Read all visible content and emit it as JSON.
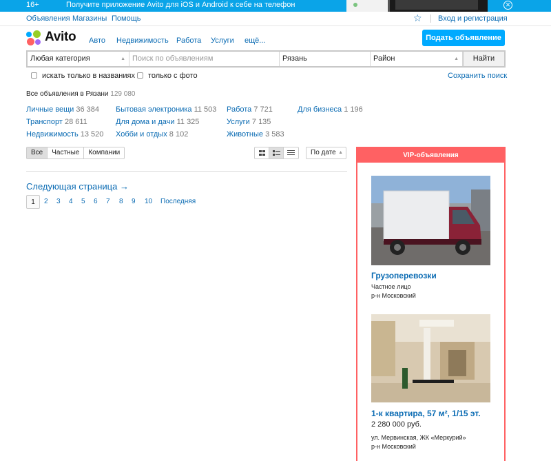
{
  "promo": {
    "age": "16+",
    "text": "Получите приложение Avito для iOS и Android к себе на телефон"
  },
  "topnav": {
    "links": [
      "Объявления",
      "Магазины",
      "Помощь"
    ],
    "login": "Вход и регистрация"
  },
  "header": {
    "logo": "Avito",
    "nav": [
      "Авто",
      "Недвижимость",
      "Работа",
      "Услуги",
      "ещё..."
    ],
    "post_button": "Подать объявление"
  },
  "search": {
    "category": "Любая категория",
    "query_placeholder": "Поиск по объявлениям",
    "city": "Рязань",
    "district": "Район",
    "submit": "Найти",
    "only_titles": "искать только в названиях",
    "only_photo": "только с фото",
    "save": "Сохранить поиск"
  },
  "summary": {
    "label": "Все объявления в Рязани",
    "count": "129 080"
  },
  "categories": [
    {
      "name": "Личные вещи",
      "count": "36 384"
    },
    {
      "name": "Транспорт",
      "count": "28 611"
    },
    {
      "name": "Недвижимость",
      "count": "13 520"
    },
    {
      "name": "Бытовая электроника",
      "count": "11 503"
    },
    {
      "name": "Для дома и дачи",
      "count": "11 325"
    },
    {
      "name": "Хобби и отдых",
      "count": "8 102"
    },
    {
      "name": "Работа",
      "count": "7 721"
    },
    {
      "name": "Услуги",
      "count": "7 135"
    },
    {
      "name": "Животные",
      "count": "3 583"
    },
    {
      "name": "Для бизнеса",
      "count": "1 196"
    }
  ],
  "filters": {
    "seller": [
      "Все",
      "Частные",
      "Компании"
    ],
    "seller_selected": "Все",
    "view_selected": "list",
    "sort": "По дате"
  },
  "pagination": {
    "next": "Следующая страница →",
    "current": "1",
    "pages": [
      "2",
      "3",
      "4",
      "5",
      "6",
      "7",
      "8",
      "9",
      "10"
    ],
    "last": "Последняя"
  },
  "vip": {
    "header": "VIP-объявления",
    "items": [
      {
        "title": "Грузоперевозки",
        "seller": "Частное лицо",
        "district": "р-н Московский"
      },
      {
        "title": "1-к квартира, 57 м², 1/15 эт.",
        "price": "2 280 000 руб.",
        "address": "ул. Мервинская, ЖК «Меркурий»",
        "district": "р-н Московский"
      }
    ]
  },
  "colors": {
    "promo": "#0aa4e8",
    "link": "#0a6bb3",
    "accent_button": "#00aaff",
    "vip": "#ff6163"
  }
}
